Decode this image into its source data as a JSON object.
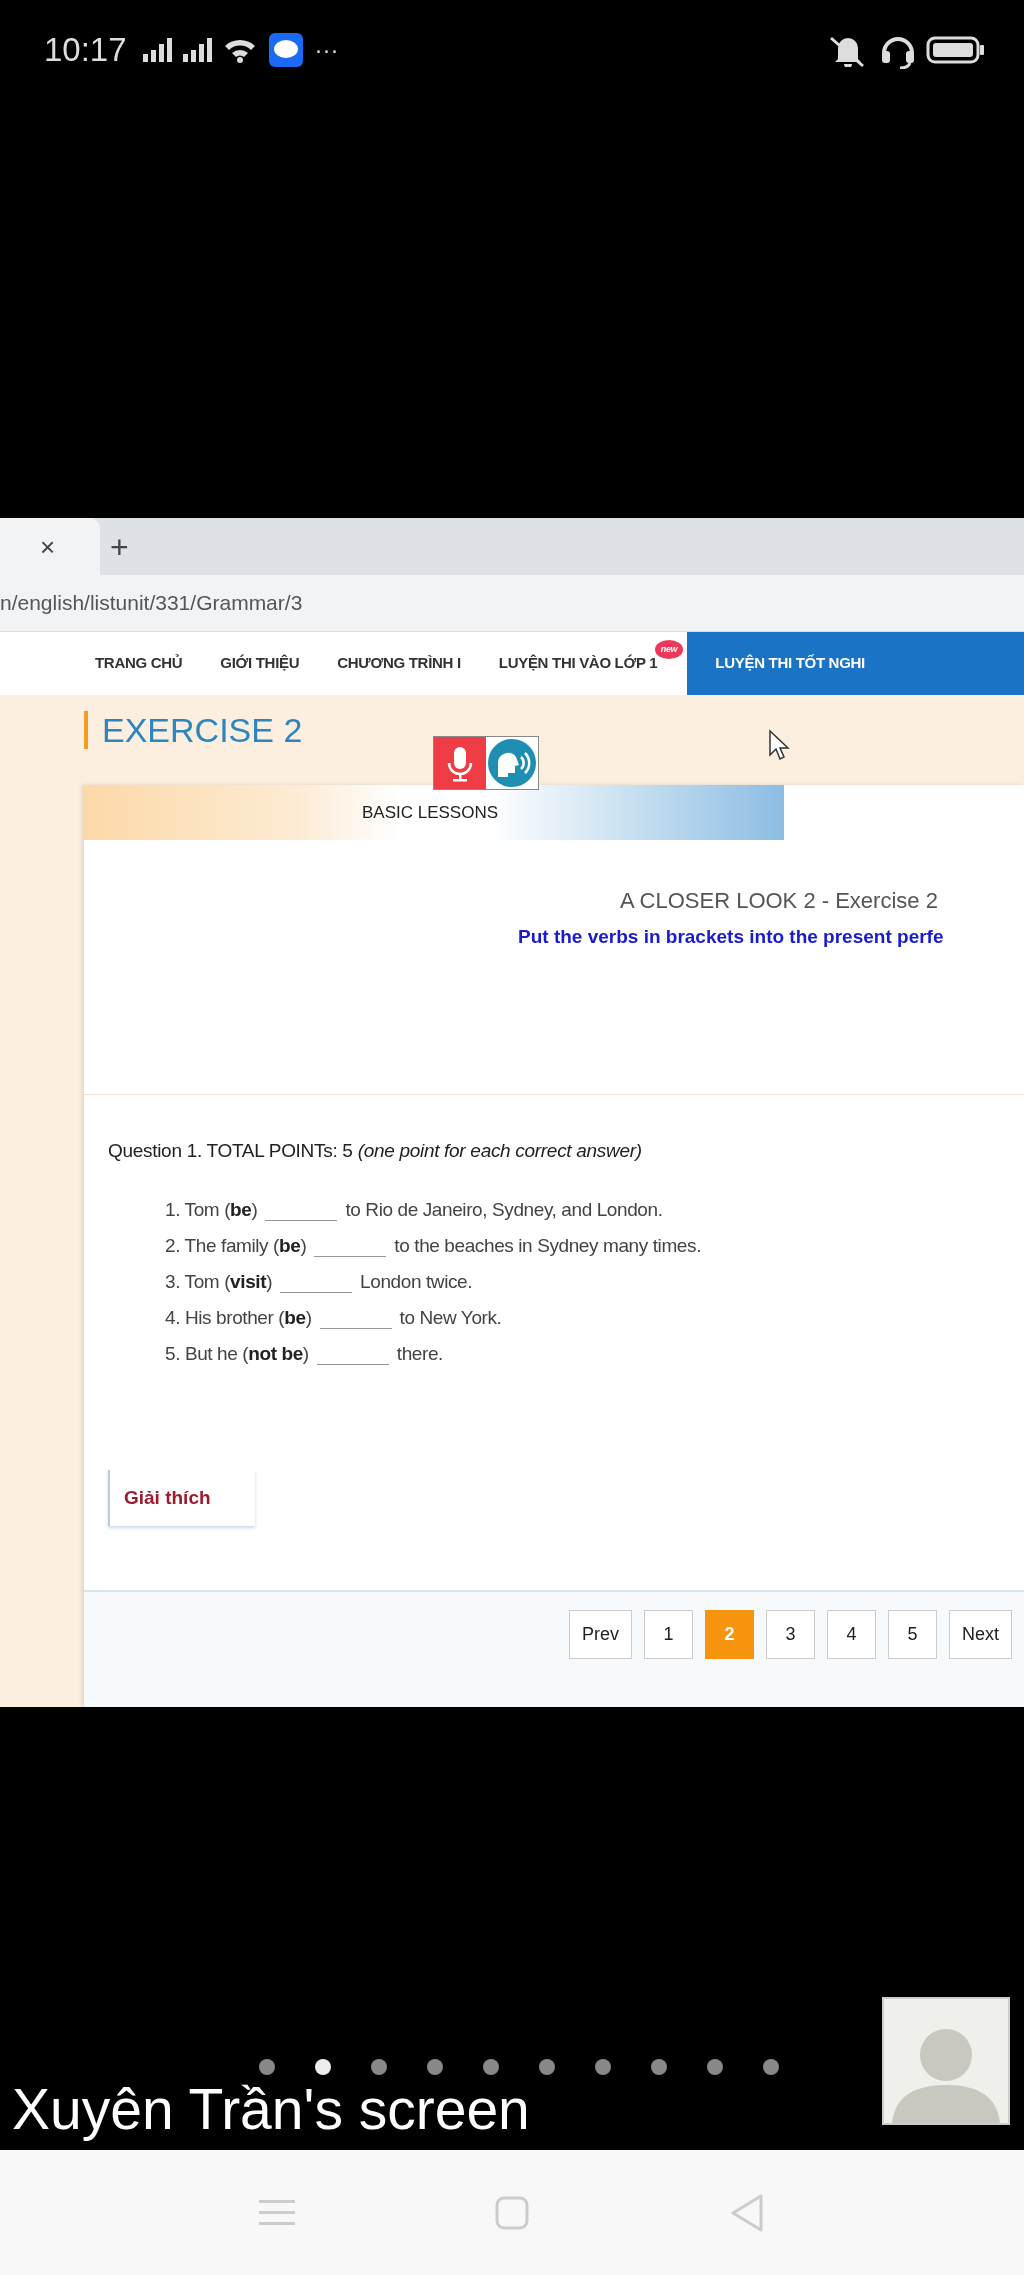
{
  "status_bar": {
    "time": "10:17",
    "more": "···"
  },
  "browser": {
    "tab_close": "×",
    "new_tab": "+",
    "url": "n/english/listunit/331/Grammar/3"
  },
  "nav": {
    "items": [
      {
        "label": "TRANG CHỦ",
        "selected": false
      },
      {
        "label": "GIỚI THIỆU",
        "selected": false
      },
      {
        "label": "CHƯƠNG TRÌNH I",
        "selected": false
      },
      {
        "label": "LUYỆN THI VÀO LỚP 1",
        "selected": false,
        "badge": "new"
      },
      {
        "label": "LUYỆN THI TỐT NGHI",
        "selected": true
      }
    ]
  },
  "exercise": {
    "heading": "EXERCISE 2",
    "banner": "BASIC LESSONS",
    "title": "A CLOSER LOOK 2 - Exercise 2",
    "instruction": "Put the verbs in brackets into the present perfe"
  },
  "question": {
    "header": "Question 1. TOTAL POINTs: 5 *(one point for each correct answer)*",
    "items": [
      {
        "before": "1. Tom (**be**)",
        "after": "to Rio de Janeiro, Sydney, and London."
      },
      {
        "before": "2. The family (**be**)",
        "after": "to the beaches in Sydney many times."
      },
      {
        "before": "3. Tom (**visit**)",
        "after": "London twice."
      },
      {
        "before": "4. His brother (**be**)",
        "after": "to New York."
      },
      {
        "before": "5. But he (**not be**)",
        "after": "there."
      }
    ]
  },
  "explain_button": "Giải thích",
  "pagination": [
    {
      "label": "Prev",
      "selected": false
    },
    {
      "label": "1",
      "selected": false
    },
    {
      "label": "2",
      "selected": true
    },
    {
      "label": "3",
      "selected": false
    },
    {
      "label": "4",
      "selected": false
    },
    {
      "label": "5",
      "selected": false
    },
    {
      "label": "Next",
      "selected": false
    }
  ],
  "share": {
    "caption": "Xuyên Trần's screen",
    "pages": [
      {
        "selected": false
      },
      {
        "selected": true
      },
      {
        "selected": false
      },
      {
        "selected": false
      },
      {
        "selected": false
      },
      {
        "selected": false
      },
      {
        "selected": false
      },
      {
        "selected": false
      },
      {
        "selected": false
      },
      {
        "selected": false
      }
    ]
  }
}
